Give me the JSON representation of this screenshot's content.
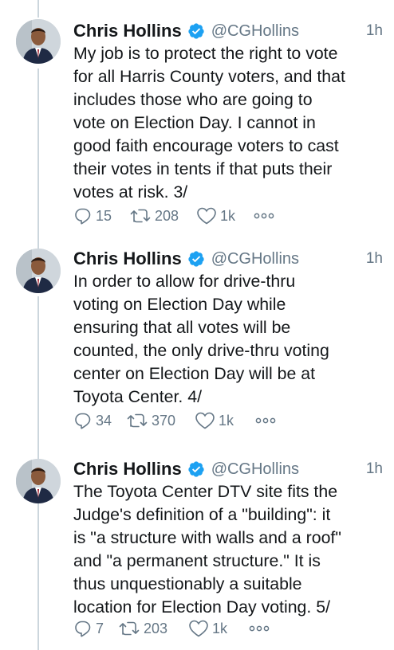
{
  "colors": {
    "text": "#14171a",
    "secondary": "#657786",
    "verified_blue": "#1da1f2",
    "thread_line": "#ccd6dd"
  },
  "tweets": [
    {
      "author_name": "Chris Hollins",
      "verified_icon": "verified-badge-icon",
      "handle": "@CGHollins",
      "time": "1h",
      "text": "My job is to protect the right to vote\nfor all Harris County voters, and that\nincludes those who are going to\nvote on Election Day. I cannot in\ngood faith encourage voters to cast\ntheir votes in tents if that puts their\nvotes at risk. 3/",
      "replies": "15",
      "retweets": "208",
      "likes": "1k"
    },
    {
      "author_name": "Chris Hollins",
      "verified_icon": "verified-badge-icon",
      "handle": "@CGHollins",
      "time": "1h",
      "text": "In order to allow for drive-thru\nvoting on Election Day while\nensuring that all votes will be\ncounted, the only drive-thru voting\ncenter on Election Day will be at\nToyota Center. 4/",
      "replies": "34",
      "retweets": "370",
      "likes": "1k"
    },
    {
      "author_name": "Chris Hollins",
      "verified_icon": "verified-badge-icon",
      "handle": "@CGHollins",
      "time": "1h",
      "text": "The Toyota Center DTV site fits the\nJudge's definition of a \"building\": it\nis \"a structure with walls and a roof\"\nand \"a permanent structure.\" It is\nthus unquestionably a suitable\nlocation for Election Day voting. 5/",
      "replies": "7",
      "retweets": "203",
      "likes": "1k"
    }
  ]
}
